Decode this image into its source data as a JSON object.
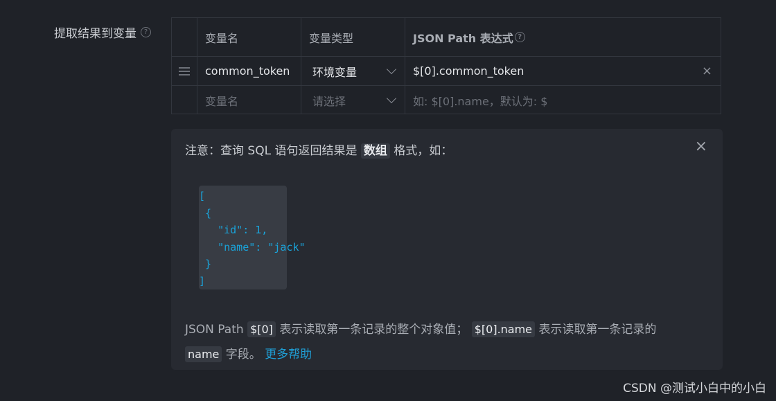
{
  "field": {
    "label": "提取结果到变量",
    "help": "?"
  },
  "table": {
    "headers": [
      "变量名",
      "变量类型",
      "JSON Path 表达式"
    ],
    "header_help": "?",
    "rows": [
      {
        "name": "common_token",
        "type": "环境变量",
        "path": "$[0].common_token"
      }
    ],
    "new_row": {
      "name_placeholder": "变量名",
      "type_placeholder": "请选择",
      "path_placeholder": "如: $[0].name，默认为: $"
    },
    "remove_icon": "×"
  },
  "notice": {
    "title_prefix": "注意：查询 SQL 语句返回结果是",
    "title_highlight": "数组",
    "title_suffix": "格式，如：",
    "close_icon": "×",
    "code_sample": "[\n {\n   \"id\": 1,\n   \"name\": \"jack\"\n }\n]",
    "footer": {
      "part1": "JSON Path",
      "chip1": "$[0]",
      "part2": "表示读取第一条记录的整个对象值；",
      "chip2": "$[0].name",
      "part3": "表示读取第一条记录的",
      "chip3": "name",
      "part4": "字段。",
      "link": "更多帮助"
    }
  },
  "watermark": "CSDN @测试小白中的小白",
  "colors": {
    "background": "#1f2228",
    "panel": "#272a31",
    "accent": "#1f9fd6"
  }
}
